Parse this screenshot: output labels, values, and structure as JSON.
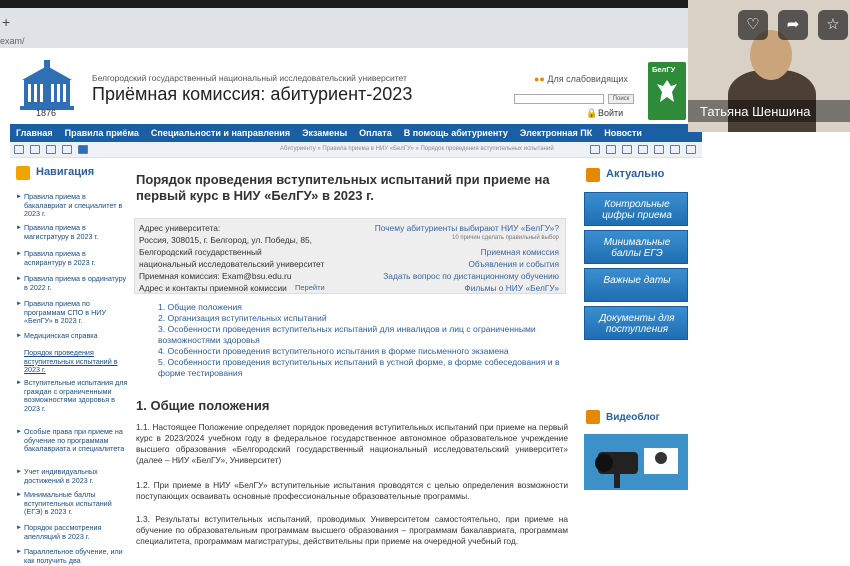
{
  "browser": {
    "tab_plus": "+",
    "address": "exam/"
  },
  "header": {
    "logo_year": "1876",
    "university": "Белгородский государственный национальный исследовательский университет",
    "commission": "Приёмная комиссия: абитуриент-2023",
    "vision_link": "Для слабовидящих",
    "search_button": "Поиск",
    "login": "Войти",
    "belgu_logo_text": "БелГУ"
  },
  "menu": [
    "Главная",
    "Правила приёма",
    "Специальности и направления",
    "Экзамены",
    "Оплата",
    "В помощь абитуриенту",
    "Электронная ПК",
    "Новости"
  ],
  "breadcrumbs": "Абитуриенту » Правила приема в НИУ «БелГУ» » Порядок проведения вступительных испытаний",
  "sidebar": {
    "title": "Навигация",
    "items": [
      "Правила приема в бакалавриат и специалитет в 2023 г.",
      "Правила приема в магистратуру в 2023 г.",
      "Правила приема в аспирантуру в 2023 г.",
      "Правила приема в ординатуру в 2022 г.",
      "Правила приема по программам СПО в НИУ «БелГУ» в 2023 г.",
      "Медицинская справка",
      "Порядок проведения вступительных испытаний в 2023 г.",
      "Вступительные испытания для граждан с ограниченными возможностями здоровья в 2023 г.",
      "Особые права при приеме на обучение по программам бакалавриата и специалитета",
      "Учет индивидуальных достижений в 2023 г.",
      "Минимальные баллы вступительных испытаний (ЕГЭ) в 2023 г.",
      "Порядок рассмотрения апелляций в 2023 г.",
      "Параллельное обучение, или как получить два"
    ]
  },
  "content": {
    "title": "Порядок проведения вступительных испытаний при приеме на первый курс в НИУ «БелГУ» в 2023 г.",
    "info_left": [
      "Адрес университета:",
      "Россия, 308015, г. Белгород, ул. Победы, 85,",
      "Белгородский государственный",
      "национальный исследовательский университет",
      "Приемная комиссия: Exam@bsu.edu.ru",
      "Адрес и контакты приемной комиссии"
    ],
    "go_link": "Перейти",
    "info_right": [
      "Почему абитуриенты выбирают НИУ «БелГУ»?",
      "10 причин сделать правильный выбор",
      "Приемная комиссия",
      "Объявления и события",
      "Задать вопрос по дистанционному обучению",
      "Фильмы о НИУ «БелГУ»"
    ],
    "toc": [
      "1.  Общие положения",
      "2.  Организация вступительных испытаний",
      "3.  Особенности проведения вступительных испытаний для инвалидов и лиц с ограниченными возможностями здоровья",
      "4.  Особенности проведения вступительного испытания в форме письменного экзамена",
      "5.  Особенности проведения вступительных испытаний в устной форме, в форме собеседования и в форме тестирования"
    ],
    "section_title": "1. Общие положения",
    "paragraphs": [
      "1.1. Настоящее Положение определяет порядок проведения вступительных испытаний при приеме на первый курс в 2023/2024 учебном году в федеральное государственное автономное образовательное учреждение высшего образования «Белгородский государственный национальный исследовательский университет» (далее – НИУ «БелГУ», Университет)",
      "1.2. При приеме в НИУ «БелГУ» вступительные испытания проводятся с целью определения возможности поступающих осваивать основные профессиональные образовательные программы.",
      "1.3. Результаты вступительных испытаний, проводимых Университетом самостоятельно, при приеме на обучение по образовательным программам высшего образования – программам бакалавриата, программам специалитета, программам магистратуры, действительны при приеме на очередной учебный год."
    ]
  },
  "right": {
    "title": "Актуально",
    "banners": [
      "Контрольные цифры приема",
      "Минимальные баллы ЕГЭ",
      "Важные даты",
      "Документы для поступления"
    ],
    "videoblog": "Видеоблог"
  },
  "video_call": {
    "name": "Татьяна Шеншина"
  },
  "colors": {
    "menu": "#1a5ea4",
    "link": "#2e5c9b",
    "accent": "#e58a00"
  }
}
